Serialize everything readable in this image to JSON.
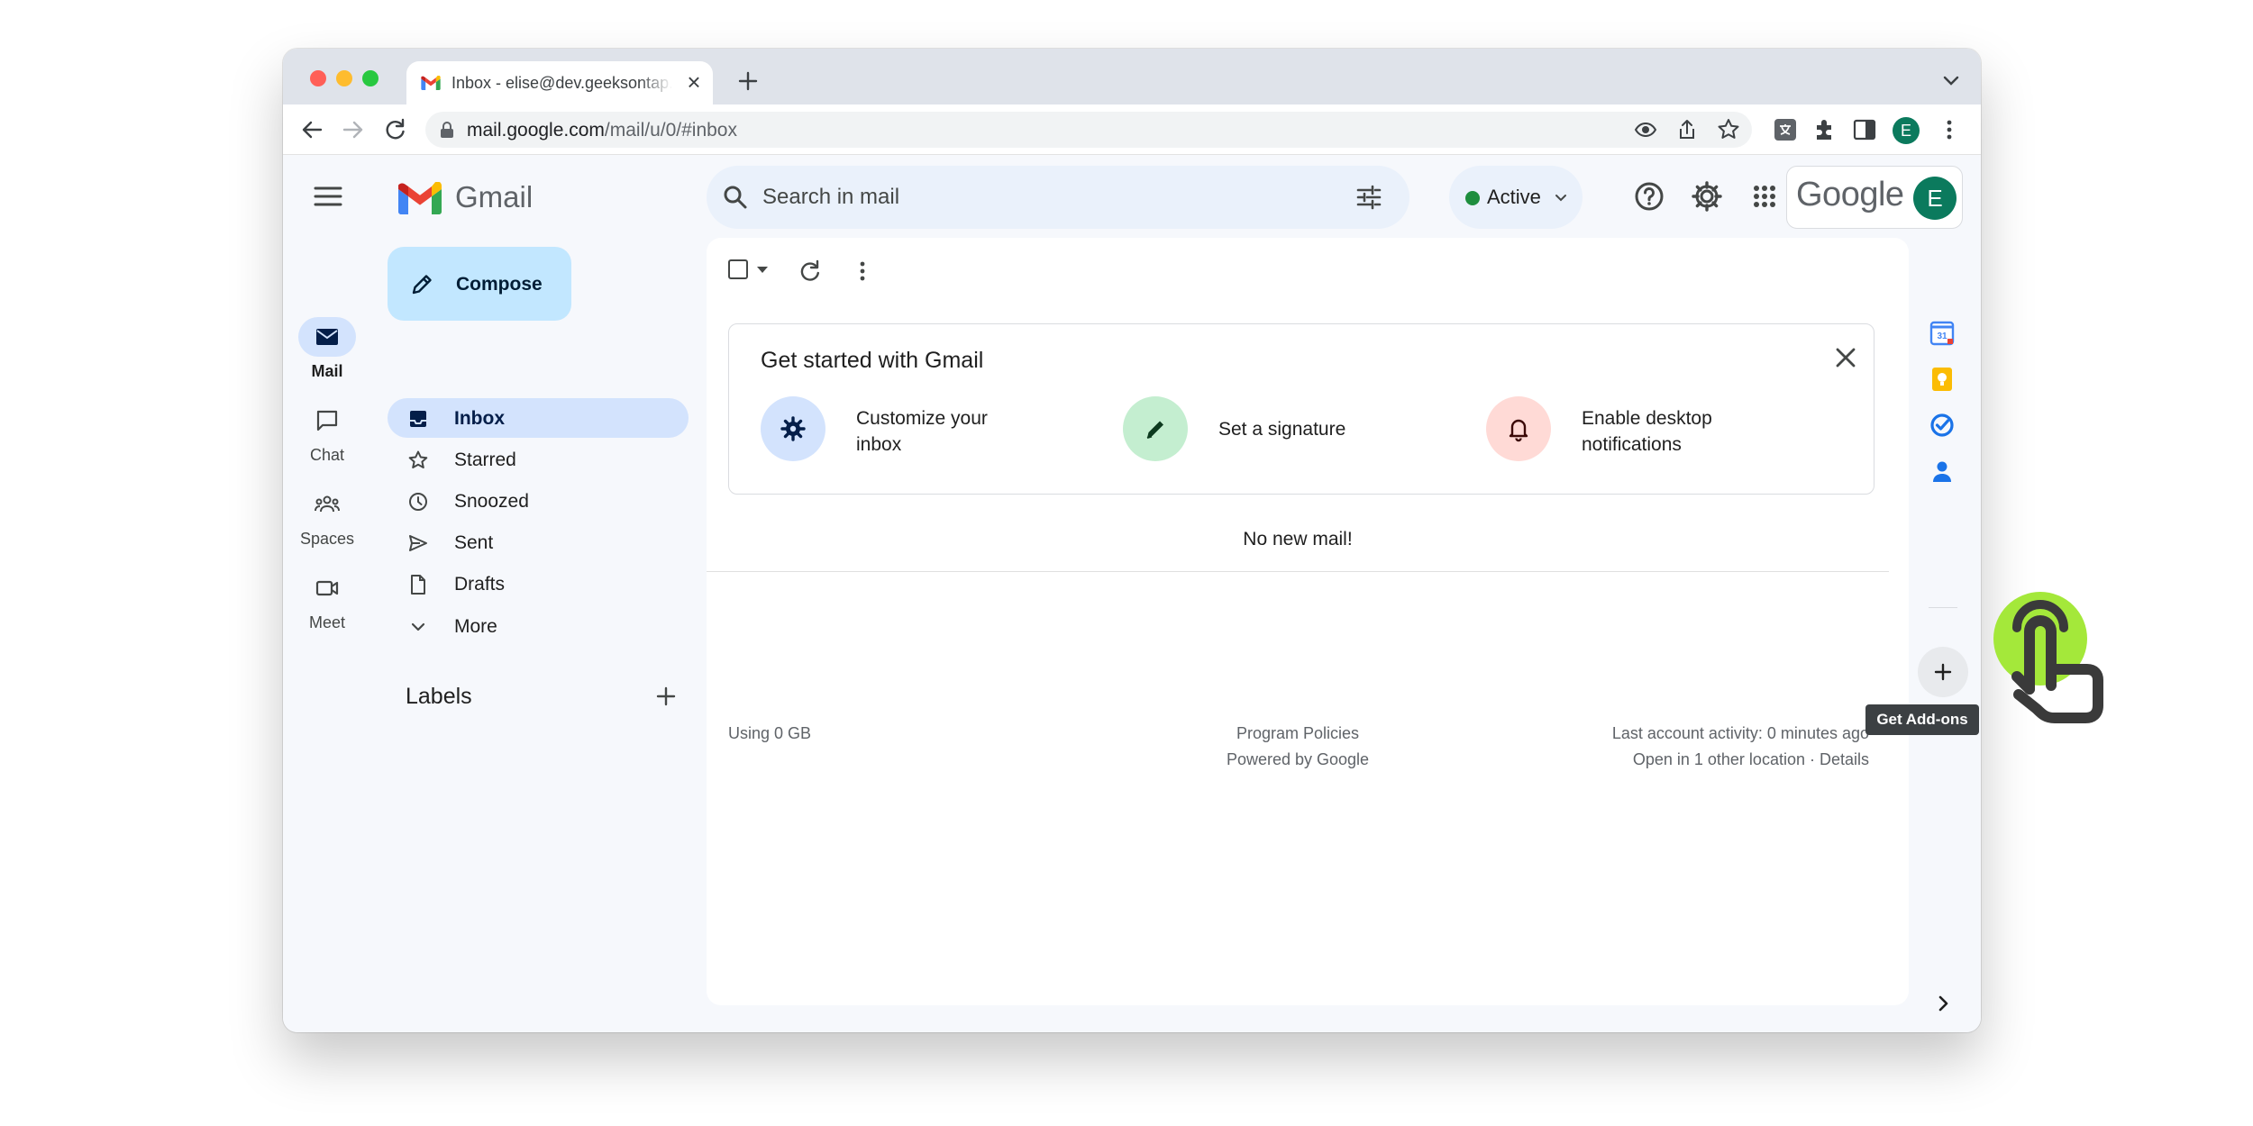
{
  "browser": {
    "tab_title": "Inbox - elise@dev.geeksontap.com",
    "url_host": "mail.google.com",
    "url_path": "/mail/u/0/#inbox",
    "profile_initial": "E"
  },
  "header": {
    "app_name": "Gmail",
    "search_placeholder": "Search in mail",
    "status": "Active",
    "google_wordmark": "Google",
    "avatar_initial": "E"
  },
  "rail": {
    "items": [
      {
        "label": "Mail",
        "icon": "mail-icon",
        "active": true
      },
      {
        "label": "Chat",
        "icon": "chat-icon"
      },
      {
        "label": "Spaces",
        "icon": "spaces-icon"
      },
      {
        "label": "Meet",
        "icon": "meet-icon"
      }
    ]
  },
  "nav": {
    "compose_label": "Compose",
    "items": [
      {
        "label": "Inbox",
        "icon": "inbox-icon",
        "selected": true
      },
      {
        "label": "Starred",
        "icon": "star-icon"
      },
      {
        "label": "Snoozed",
        "icon": "clock-icon"
      },
      {
        "label": "Sent",
        "icon": "send-icon"
      },
      {
        "label": "Drafts",
        "icon": "draft-icon"
      },
      {
        "label": "More",
        "icon": "chevron-down-icon"
      }
    ],
    "labels_title": "Labels"
  },
  "main": {
    "get_started": {
      "title": "Get started with Gmail",
      "items": [
        {
          "line1": "Customize your",
          "line2": "inbox",
          "icon": "gear-icon",
          "color": "#d3e3fd"
        },
        {
          "line1": "Set a signature",
          "icon": "pen-icon",
          "color": "#c4eed0"
        },
        {
          "line1": "Enable desktop",
          "line2": "notifications",
          "icon": "bell-icon",
          "color": "#ffdad6"
        }
      ]
    },
    "empty_message": "No new mail!",
    "footer": {
      "storage": "Using 0 GB",
      "program_policies": "Program Policies",
      "powered_by": "Powered by Google",
      "last_activity": "Last account activity: 0 minutes ago",
      "open_locations": "Open in 1 other location · Details"
    }
  },
  "side_panel": {
    "apps": [
      "calendar-icon",
      "keep-icon",
      "tasks-icon",
      "contacts-icon"
    ],
    "addons_tooltip": "Get Add-ons"
  },
  "colors": {
    "accent": "#0b57d0",
    "compose_bg": "#c2e7ff",
    "selected_bg": "#d3e3fd",
    "status_green": "#1e8e3e",
    "tap_indicator": "#a4e83a"
  }
}
